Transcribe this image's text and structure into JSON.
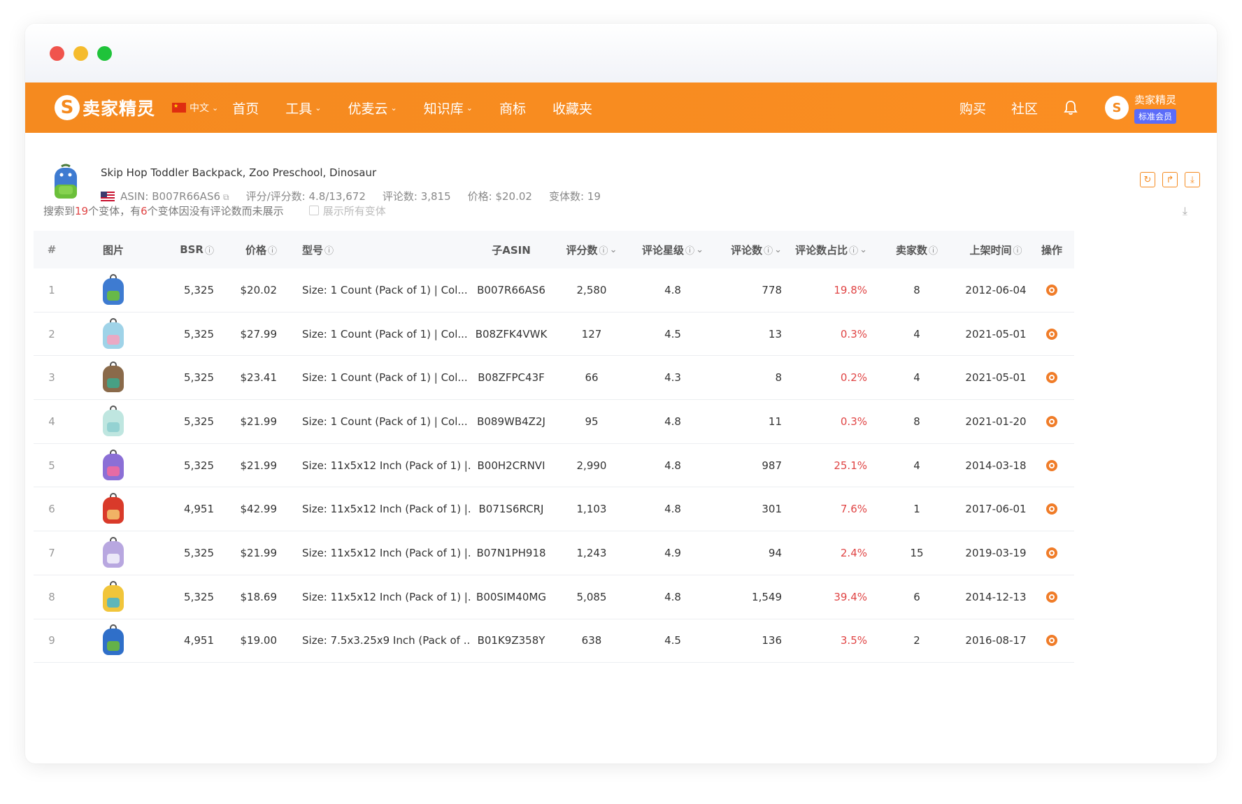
{
  "nav": {
    "logo": "卖家精灵",
    "logo_mark": "S",
    "lang": "中文",
    "items": [
      "首页",
      "工具",
      "优麦云",
      "知识库",
      "商标",
      "收藏夹"
    ],
    "right_items": [
      "购买",
      "社区"
    ],
    "user_name": "卖家精灵",
    "member": "标准会员"
  },
  "product": {
    "title": "Skip Hop Toddler Backpack, Zoo Preschool, Dinosaur",
    "asin": "ASIN: B007R66AS6",
    "rating": "评分/评分数: 4.8/13,672",
    "reviews": "评论数: 3,815",
    "price": "价格: $20.02",
    "variants": "变体数: 19"
  },
  "summary": {
    "p1": "搜索到",
    "n1": "19",
    "p2": "个变体，有",
    "n2": "6",
    "p3": "个变体因没有评论数而未展示",
    "show_all": "展示所有变体"
  },
  "table": {
    "headers": {
      "idx": "#",
      "img": "图片",
      "bsr": "BSR",
      "price": "价格",
      "model": "型号",
      "asin": "子ASIN",
      "rating_cnt": "评分数",
      "stars": "评论星级",
      "reviews": "评论数",
      "ratio": "评论数占比",
      "sellers": "卖家数",
      "date": "上架时间",
      "op": "操作"
    },
    "rows": [
      {
        "idx": "1",
        "bsr": "5,325",
        "price": "$20.02",
        "model": "Size: 1 Count (Pack of 1) | Col...",
        "asin": "B007R66AS6",
        "rating_cnt": "2,580",
        "stars": "4.8",
        "reviews": "778",
        "ratio": "19.8%",
        "sellers": "8",
        "date": "2012-06-04"
      },
      {
        "idx": "2",
        "bsr": "5,325",
        "price": "$27.99",
        "model": "Size: 1 Count (Pack of 1) | Col...",
        "asin": "B08ZFK4VWK",
        "rating_cnt": "127",
        "stars": "4.5",
        "reviews": "13",
        "ratio": "0.3%",
        "sellers": "4",
        "date": "2021-05-01"
      },
      {
        "idx": "3",
        "bsr": "5,325",
        "price": "$23.41",
        "model": "Size: 1 Count (Pack of 1) | Col...",
        "asin": "B08ZFPC43F",
        "rating_cnt": "66",
        "stars": "4.3",
        "reviews": "8",
        "ratio": "0.2%",
        "sellers": "4",
        "date": "2021-05-01"
      },
      {
        "idx": "4",
        "bsr": "5,325",
        "price": "$21.99",
        "model": "Size: 1 Count (Pack of 1) | Col...",
        "asin": "B089WB4Z2J",
        "rating_cnt": "95",
        "stars": "4.8",
        "reviews": "11",
        "ratio": "0.3%",
        "sellers": "8",
        "date": "2021-01-20"
      },
      {
        "idx": "5",
        "bsr": "5,325",
        "price": "$21.99",
        "model": "Size: 11x5x12 Inch (Pack of 1) |...",
        "asin": "B00H2CRNVI",
        "rating_cnt": "2,990",
        "stars": "4.8",
        "reviews": "987",
        "ratio": "25.1%",
        "sellers": "4",
        "date": "2014-03-18"
      },
      {
        "idx": "6",
        "bsr": "4,951",
        "price": "$42.99",
        "model": "Size: 11x5x12 Inch (Pack of 1) |...",
        "asin": "B071S6RCRJ",
        "rating_cnt": "1,103",
        "stars": "4.8",
        "reviews": "301",
        "ratio": "7.6%",
        "sellers": "1",
        "date": "2017-06-01"
      },
      {
        "idx": "7",
        "bsr": "5,325",
        "price": "$21.99",
        "model": "Size: 11x5x12 Inch (Pack of 1) |...",
        "asin": "B07N1PH918",
        "rating_cnt": "1,243",
        "stars": "4.9",
        "reviews": "94",
        "ratio": "2.4%",
        "sellers": "15",
        "date": "2019-03-19"
      },
      {
        "idx": "8",
        "bsr": "5,325",
        "price": "$18.69",
        "model": "Size: 11x5x12 Inch (Pack of 1) |...",
        "asin": "B00SIM40MG",
        "rating_cnt": "5,085",
        "stars": "4.8",
        "reviews": "1,549",
        "ratio": "39.4%",
        "sellers": "6",
        "date": "2014-12-13"
      },
      {
        "idx": "9",
        "bsr": "4,951",
        "price": "$19.00",
        "model": "Size: 7.5x3.25x9 Inch (Pack of ...",
        "asin": "B01K9Z358Y",
        "rating_cnt": "638",
        "stars": "4.5",
        "reviews": "136",
        "ratio": "3.5%",
        "sellers": "2",
        "date": "2016-08-17"
      }
    ]
  },
  "colors": {
    "brand_orange": "#f58a1f",
    "ratio_red": "#e04545",
    "member_badge": "#5b6cf9",
    "thumbs": [
      [
        "#3e7bd1",
        "#6bbf3a"
      ],
      [
        "#9fd3e8",
        "#f2a4c0"
      ],
      [
        "#8a6a4a",
        "#3fa68b"
      ],
      [
        "#bfe6e0",
        "#8fcfd0"
      ],
      [
        "#8b6fd6",
        "#f06aa0"
      ],
      [
        "#d93a2a",
        "#f3c06b"
      ],
      [
        "#b8a7e0",
        "#f1eefb"
      ],
      [
        "#f1c53a",
        "#4fb4c7"
      ],
      [
        "#2f6fc9",
        "#6ab83a"
      ]
    ]
  }
}
